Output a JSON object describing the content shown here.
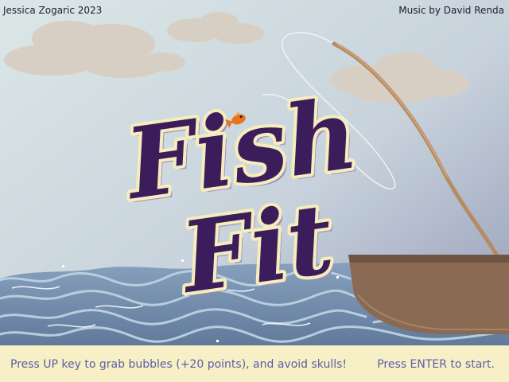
{
  "credits": {
    "author": "Jessica Zogaric 2023",
    "music": "Music by David Renda"
  },
  "title": {
    "line1": "Fish",
    "line2": "Fit"
  },
  "footer": {
    "instructions": "Press UP key to grab bubbles (+20 points), and avoid skulls!",
    "start_prompt": "Press ENTER to start."
  },
  "colors": {
    "title_fill": "#3c1d5c",
    "title_outline": "#f6edbd",
    "footer_text": "#5b5fa6",
    "footer_bg": "#f7efc6",
    "sea": "#6d86a8",
    "boat": "#8a6a52"
  },
  "icons": [
    "fish-icon",
    "boat-icon",
    "fishing-rod-icon"
  ]
}
